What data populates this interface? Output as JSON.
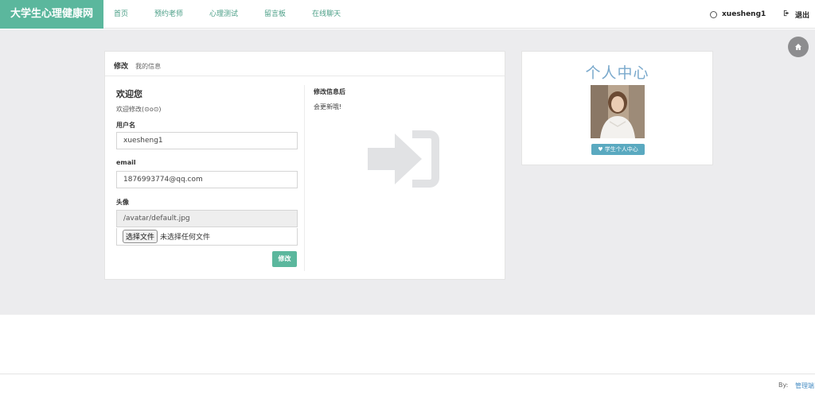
{
  "brand": "大学生心理健康网",
  "nav": [
    "首页",
    "预约老师",
    "心理测试",
    "留言板",
    "在线聊天"
  ],
  "user": {
    "name": "xuesheng1",
    "icon": "user-icon"
  },
  "logout": {
    "label": "退出",
    "icon": "logout-icon"
  },
  "home_icon": "home-icon",
  "panel": {
    "title": "修改",
    "subtitle": "我的信息",
    "welcome_title": "欢迎您",
    "welcome_sub": "欢迎修改(⊙o⊙)",
    "username_label": "用户名",
    "username_value": "xuesheng1",
    "email_label": "email",
    "email_value": "18769937​74@qq.com",
    "avatar_label": "头像",
    "avatar_value": "/avatar/default.jpg",
    "file_button": "选择文件",
    "file_status": "未选择任何文件",
    "submit": "修改",
    "right_title": "修改信息后",
    "right_sub": "会更新哦!",
    "right_icon": "sign-in-icon"
  },
  "card": {
    "title": "个人中心",
    "button": "学生个人中心",
    "button_icon": "heart-icon"
  },
  "footer": {
    "by": "By:",
    "link": "管理端"
  },
  "colors": {
    "accent": "#5bb79d",
    "card_button": "#5aa9c0",
    "card_title": "#7aa9cc",
    "link": "#4a8fc4"
  }
}
